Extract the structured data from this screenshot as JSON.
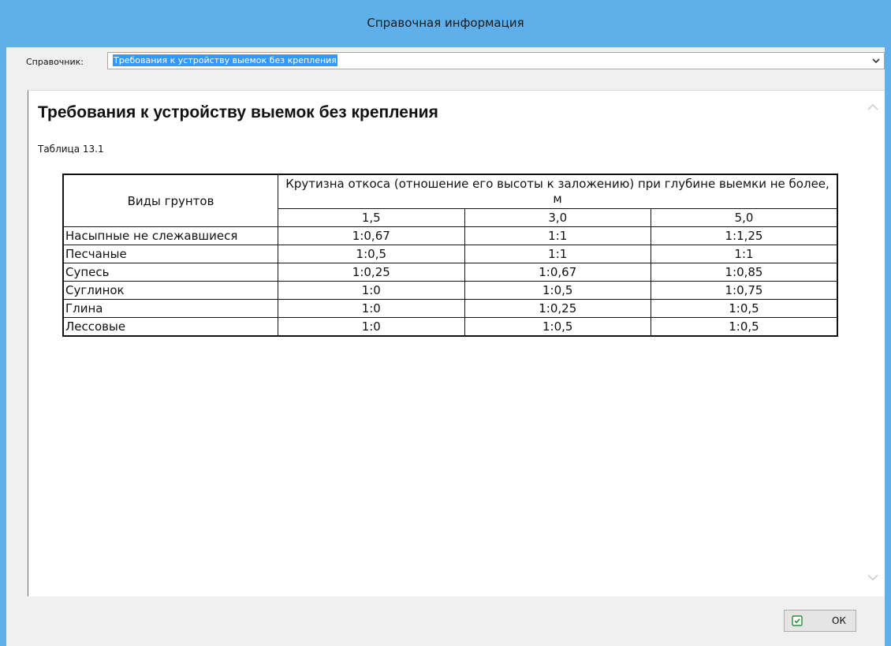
{
  "window": {
    "title": "Справочная информация"
  },
  "selector": {
    "label": "Справочник:",
    "value": "Требования к устройству выемок без крепления"
  },
  "document": {
    "title": "Требования к устройству выемок без крепления",
    "caption": "Таблица 13.1",
    "table": {
      "header_soil": "Виды грунтов",
      "header_slope": "Крутизна откоса (отношение его высоты к заложению) при глубине выемки не более, м",
      "depths": [
        "1,5",
        "3,0",
        "5,0"
      ],
      "rows": [
        {
          "soil": "Насыпные не слежавшиеся",
          "values": [
            "1:0,67",
            "1:1",
            "1:1,25"
          ]
        },
        {
          "soil": "Песчаные",
          "values": [
            "1:0,5",
            "1:1",
            "1:1"
          ]
        },
        {
          "soil": "Супесь",
          "values": [
            "1:0,25",
            "1:0,67",
            "1:0,85"
          ]
        },
        {
          "soil": "Суглинок",
          "values": [
            "1:0",
            "1:0,5",
            "1:0,75"
          ]
        },
        {
          "soil": "Глина",
          "values": [
            "1:0",
            "1:0,25",
            "1:0,5"
          ]
        },
        {
          "soil": "Лессовые",
          "values": [
            "1:0",
            "1:0,5",
            "1:0,5"
          ]
        }
      ]
    }
  },
  "buttons": {
    "ok_label": "ОК"
  },
  "icons": {
    "dropdown": "chevron-down-icon",
    "scroll_up": "chevron-up-icon",
    "scroll_down": "chevron-down-icon",
    "ok": "check-icon"
  },
  "colors": {
    "titlebar": "#5fb0ea",
    "selection": "#3399ff",
    "ok_icon": "#2e8b3a"
  }
}
